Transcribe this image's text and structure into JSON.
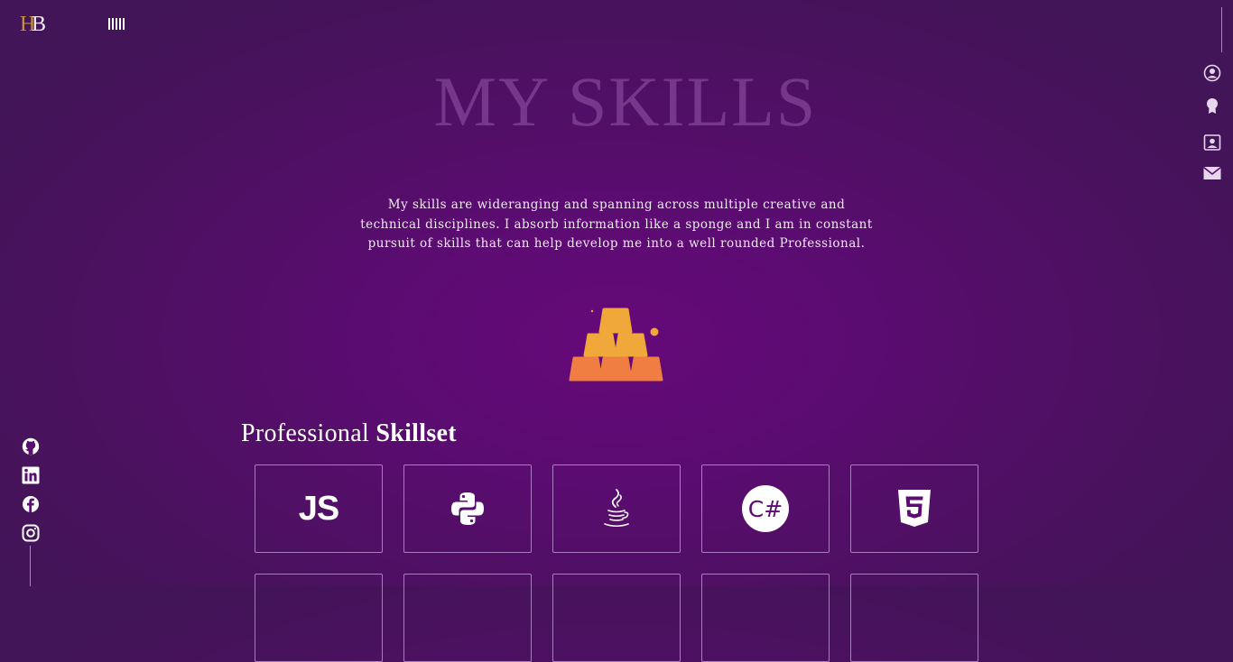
{
  "header": {
    "logo_letter_1": "H",
    "logo_letter_2": "B",
    "menu_icon": "menu-bars-icon"
  },
  "right_nav": {
    "items": [
      {
        "icon": "user-circle-icon"
      },
      {
        "icon": "award-icon"
      },
      {
        "icon": "contact-card-icon"
      },
      {
        "icon": "envelope-icon"
      }
    ]
  },
  "social": {
    "items": [
      {
        "icon": "github-icon"
      },
      {
        "icon": "linkedin-icon"
      },
      {
        "icon": "facebook-icon"
      },
      {
        "icon": "instagram-icon"
      }
    ]
  },
  "page": {
    "title": "MY SKILLS",
    "intro": "My skills are wideranging and spanning across multiple creative and technical disciplines. I absorb information like a sponge and I am in constant pursuit of skills that can help develop me into a well rounded Professional.",
    "illustration": "gold-bars-icon"
  },
  "skillset": {
    "heading_light": "Professional",
    "heading_bold": "Skillset",
    "cards": [
      {
        "icon": "javascript-icon",
        "text": "JS"
      },
      {
        "icon": "python-icon"
      },
      {
        "icon": "java-icon"
      },
      {
        "icon": "csharp-icon",
        "text": "C#"
      },
      {
        "icon": "html5-icon"
      }
    ]
  },
  "colors": {
    "background": "#5a0c70",
    "accent_gold": "#c8903a",
    "card_border": "#c8a0dc",
    "bar_top": "#f0a83a",
    "bar_bottom": "#f07e42"
  }
}
